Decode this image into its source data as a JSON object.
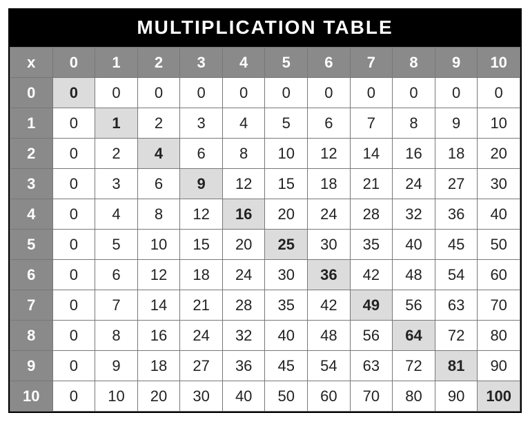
{
  "title": "MULTIPLICATION TABLE",
  "corner": "x",
  "columns": [
    "0",
    "1",
    "2",
    "3",
    "4",
    "5",
    "6",
    "7",
    "8",
    "9",
    "10"
  ],
  "rows": [
    {
      "label": "0",
      "cells": [
        "0",
        "0",
        "0",
        "0",
        "0",
        "0",
        "0",
        "0",
        "0",
        "0",
        "0"
      ]
    },
    {
      "label": "1",
      "cells": [
        "0",
        "1",
        "2",
        "3",
        "4",
        "5",
        "6",
        "7",
        "8",
        "9",
        "10"
      ]
    },
    {
      "label": "2",
      "cells": [
        "0",
        "2",
        "4",
        "6",
        "8",
        "10",
        "12",
        "14",
        "16",
        "18",
        "20"
      ]
    },
    {
      "label": "3",
      "cells": [
        "0",
        "3",
        "6",
        "9",
        "12",
        "15",
        "18",
        "21",
        "24",
        "27",
        "30"
      ]
    },
    {
      "label": "4",
      "cells": [
        "0",
        "4",
        "8",
        "12",
        "16",
        "20",
        "24",
        "28",
        "32",
        "36",
        "40"
      ]
    },
    {
      "label": "5",
      "cells": [
        "0",
        "5",
        "10",
        "15",
        "20",
        "25",
        "30",
        "35",
        "40",
        "45",
        "50"
      ]
    },
    {
      "label": "6",
      "cells": [
        "0",
        "6",
        "12",
        "18",
        "24",
        "30",
        "36",
        "42",
        "48",
        "54",
        "60"
      ]
    },
    {
      "label": "7",
      "cells": [
        "0",
        "7",
        "14",
        "21",
        "28",
        "35",
        "42",
        "49",
        "56",
        "63",
        "70"
      ]
    },
    {
      "label": "8",
      "cells": [
        "0",
        "8",
        "16",
        "24",
        "32",
        "40",
        "48",
        "56",
        "64",
        "72",
        "80"
      ]
    },
    {
      "label": "9",
      "cells": [
        "0",
        "9",
        "18",
        "27",
        "36",
        "45",
        "54",
        "63",
        "72",
        "81",
        "90"
      ]
    },
    {
      "label": "10",
      "cells": [
        "0",
        "10",
        "20",
        "30",
        "40",
        "50",
        "60",
        "70",
        "80",
        "90",
        "100"
      ]
    }
  ],
  "chart_data": {
    "type": "table",
    "title": "MULTIPLICATION TABLE",
    "row_headers": [
      0,
      1,
      2,
      3,
      4,
      5,
      6,
      7,
      8,
      9,
      10
    ],
    "col_headers": [
      0,
      1,
      2,
      3,
      4,
      5,
      6,
      7,
      8,
      9,
      10
    ],
    "values": [
      [
        0,
        0,
        0,
        0,
        0,
        0,
        0,
        0,
        0,
        0,
        0
      ],
      [
        0,
        1,
        2,
        3,
        4,
        5,
        6,
        7,
        8,
        9,
        10
      ],
      [
        0,
        2,
        4,
        6,
        8,
        10,
        12,
        14,
        16,
        18,
        20
      ],
      [
        0,
        3,
        6,
        9,
        12,
        15,
        18,
        21,
        24,
        27,
        30
      ],
      [
        0,
        4,
        8,
        12,
        16,
        20,
        24,
        28,
        32,
        36,
        40
      ],
      [
        0,
        5,
        10,
        15,
        20,
        25,
        30,
        35,
        40,
        45,
        50
      ],
      [
        0,
        6,
        12,
        18,
        24,
        30,
        36,
        42,
        48,
        54,
        60
      ],
      [
        0,
        7,
        14,
        21,
        28,
        35,
        42,
        49,
        56,
        63,
        70
      ],
      [
        0,
        8,
        16,
        24,
        32,
        40,
        48,
        56,
        64,
        72,
        80
      ],
      [
        0,
        9,
        18,
        27,
        36,
        45,
        54,
        63,
        72,
        81,
        90
      ],
      [
        0,
        10,
        20,
        30,
        40,
        50,
        60,
        70,
        80,
        90,
        100
      ]
    ],
    "highlight": "diagonal (perfect squares)"
  }
}
